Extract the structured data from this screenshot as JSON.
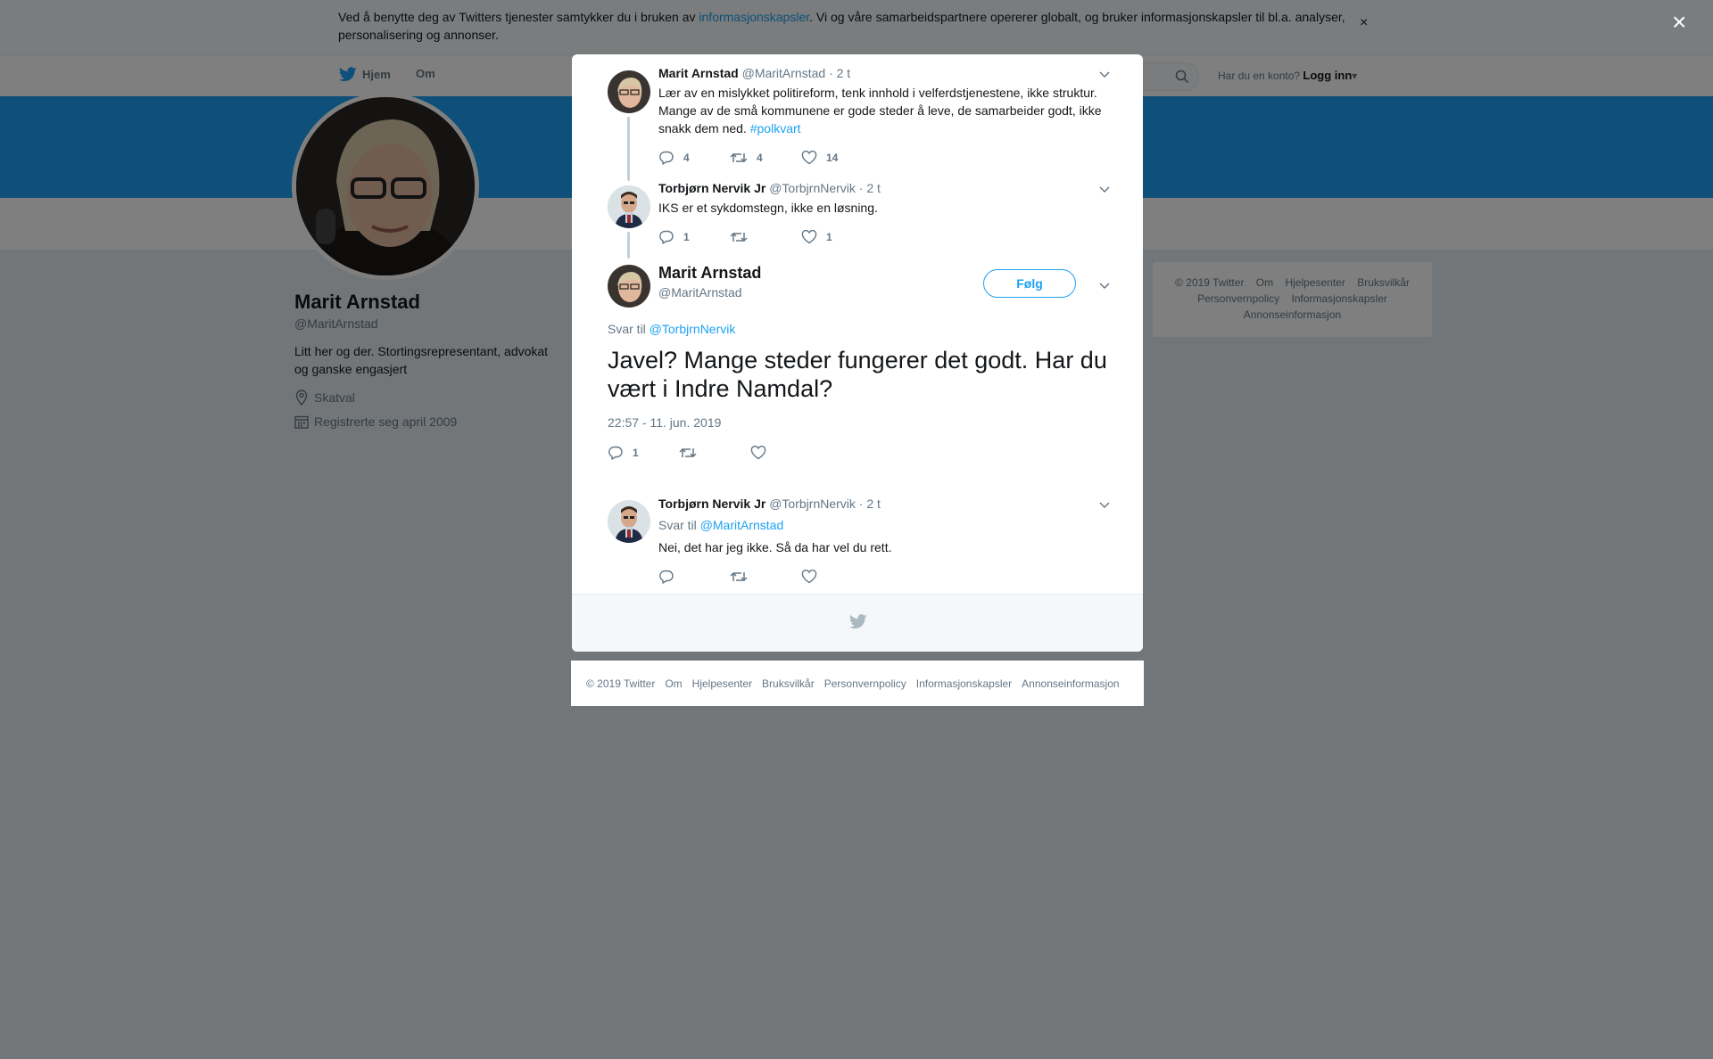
{
  "cookie": {
    "text_before": "Ved å benytte deg av Twitters tjenester samtykker du i bruken av ",
    "link": "informasjonskapsler",
    "text_after": ". Vi og våre samarbeidspartnere opererer globalt, og bruker informasjonskapsler til bl.a. analyser, personalisering og annonser.",
    "close": "×"
  },
  "nav": {
    "home": "Hjem",
    "about": "Om",
    "login_prompt": "Har du en konto?",
    "login": "Logg inn"
  },
  "profile": {
    "name": "Marit Arnstad",
    "handle": "@MaritArnstad",
    "bio": "Litt her og der. Stortingsrepresentant, advokat og ganske engasjert",
    "location": "Skatval",
    "joined": "Registrerte seg april 2009"
  },
  "right_footer": {
    "line1": [
      "© 2019 Twitter",
      "Om",
      "Hjelpesenter",
      "Bruksvilkår"
    ],
    "line2": [
      "Personvernpolicy",
      "Informasjonskapsler"
    ],
    "line3": [
      "Annonseinformasjon"
    ]
  },
  "overlay": {
    "close": "×"
  },
  "thread": {
    "tweet1": {
      "name": "Marit Arnstad",
      "handle": "@MaritArnstad",
      "time": "· 2 t",
      "text": "Lær av en mislykket politireform, tenk innhold i velferdstjenestene, ikke struktur. Mange av de små kommunene er gode steder å leve, de samarbeider godt, ikke snakk dem ned. ",
      "hashtag": "#polkvart",
      "replies": "4",
      "retweets": "4",
      "likes": "14"
    },
    "tweet2": {
      "name": "Torbjørn Nervik Jr",
      "handle": "@TorbjrnNervik",
      "time": "· 2 t",
      "text": "IKS er et sykdomstegn, ikke en løsning.",
      "replies": "1",
      "retweets": "",
      "likes": "1"
    },
    "main": {
      "name": "Marit Arnstad",
      "handle": "@MaritArnstad",
      "follow": "Følg",
      "reply_label": "Svar til ",
      "reply_to": "@TorbjrnNervik",
      "text": "Javel? Mange steder fungerer det godt. Har du vært i Indre Namdal?",
      "timestamp": "22:57 - 11. jun. 2019",
      "replies": "1"
    },
    "reply": {
      "name": "Torbjørn Nervik Jr",
      "handle": "@TorbjrnNervik",
      "time": "· 2 t",
      "reply_label": "Svar til ",
      "reply_to": "@MaritArnstad",
      "text": "Nei, det har jeg ikke. Så da har vel du rett."
    }
  },
  "bottom_footer": [
    "© 2019 Twitter",
    "Om",
    "Hjelpesenter",
    "Bruksvilkår",
    "Personvernpolicy",
    "Informasjonskapsler",
    "Annonseinformasjon"
  ],
  "colors": {
    "brand": "#1da1f2",
    "banner": "#1da1f2",
    "muted": "#657786"
  },
  "icons": [
    "twitter-bird-icon",
    "search-icon",
    "location-icon",
    "calendar-icon",
    "reply-icon",
    "retweet-icon",
    "like-icon",
    "chevron-down-icon",
    "close-icon"
  ]
}
